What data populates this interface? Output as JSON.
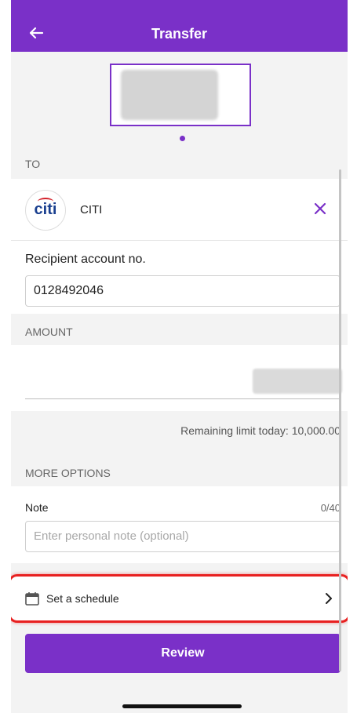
{
  "header": {
    "title": "Transfer",
    "back_icon": "arrow-left-icon"
  },
  "to_section": {
    "label": "TO",
    "bank": {
      "logo_text": "citi",
      "name": "CITI"
    },
    "clear_icon": "close-icon"
  },
  "recipient": {
    "label": "Recipient account no.",
    "value": "0128492046"
  },
  "amount_section": {
    "label": "AMOUNT"
  },
  "remaining_limit": "Remaining limit today: 10,000.00",
  "more_options": {
    "label": "MORE OPTIONS",
    "note": {
      "label": "Note",
      "counter": "0/40",
      "placeholder": "Enter personal note (optional)"
    }
  },
  "schedule": {
    "label": "Set a schedule",
    "icon": "calendar-icon",
    "chevron": "chevron-right-icon"
  },
  "review_button": "Review",
  "colors": {
    "brand": "#7a30c8",
    "highlight": "#e82020"
  }
}
